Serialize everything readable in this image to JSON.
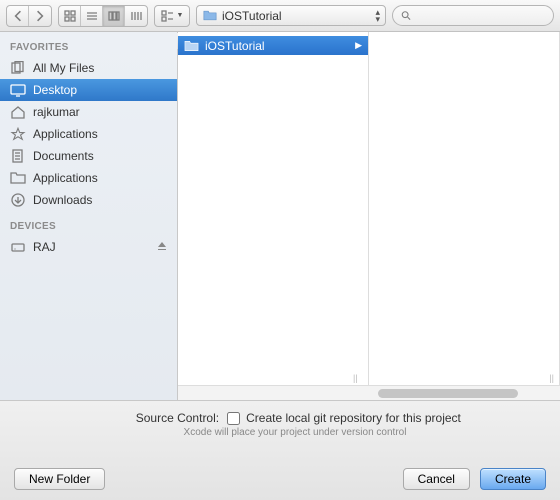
{
  "toolbar": {
    "path_label": "iOSTutorial",
    "search_placeholder": ""
  },
  "sidebar": {
    "sections": [
      {
        "header": "FAVORITES",
        "items": [
          {
            "label": "All My Files",
            "icon": "all-files"
          },
          {
            "label": "Desktop",
            "icon": "desktop",
            "selected": true
          },
          {
            "label": "rajkumar",
            "icon": "home"
          },
          {
            "label": "Applications",
            "icon": "apps"
          },
          {
            "label": "Documents",
            "icon": "documents"
          },
          {
            "label": "Applications",
            "icon": "folder"
          },
          {
            "label": "Downloads",
            "icon": "downloads"
          }
        ]
      },
      {
        "header": "DEVICES",
        "items": [
          {
            "label": "RAJ",
            "icon": "disk",
            "eject": true
          }
        ]
      }
    ]
  },
  "columns": [
    {
      "items": [
        {
          "label": "iOSTutorial",
          "icon": "folder",
          "selected": true,
          "has_children": true
        }
      ]
    },
    {
      "items": []
    }
  ],
  "source_control": {
    "label": "Source Control:",
    "checkbox_label": "Create local git repository for this project",
    "hint": "Xcode will place your project under version control",
    "checked": false
  },
  "actions": {
    "new_folder": "New Folder",
    "cancel": "Cancel",
    "create": "Create"
  }
}
